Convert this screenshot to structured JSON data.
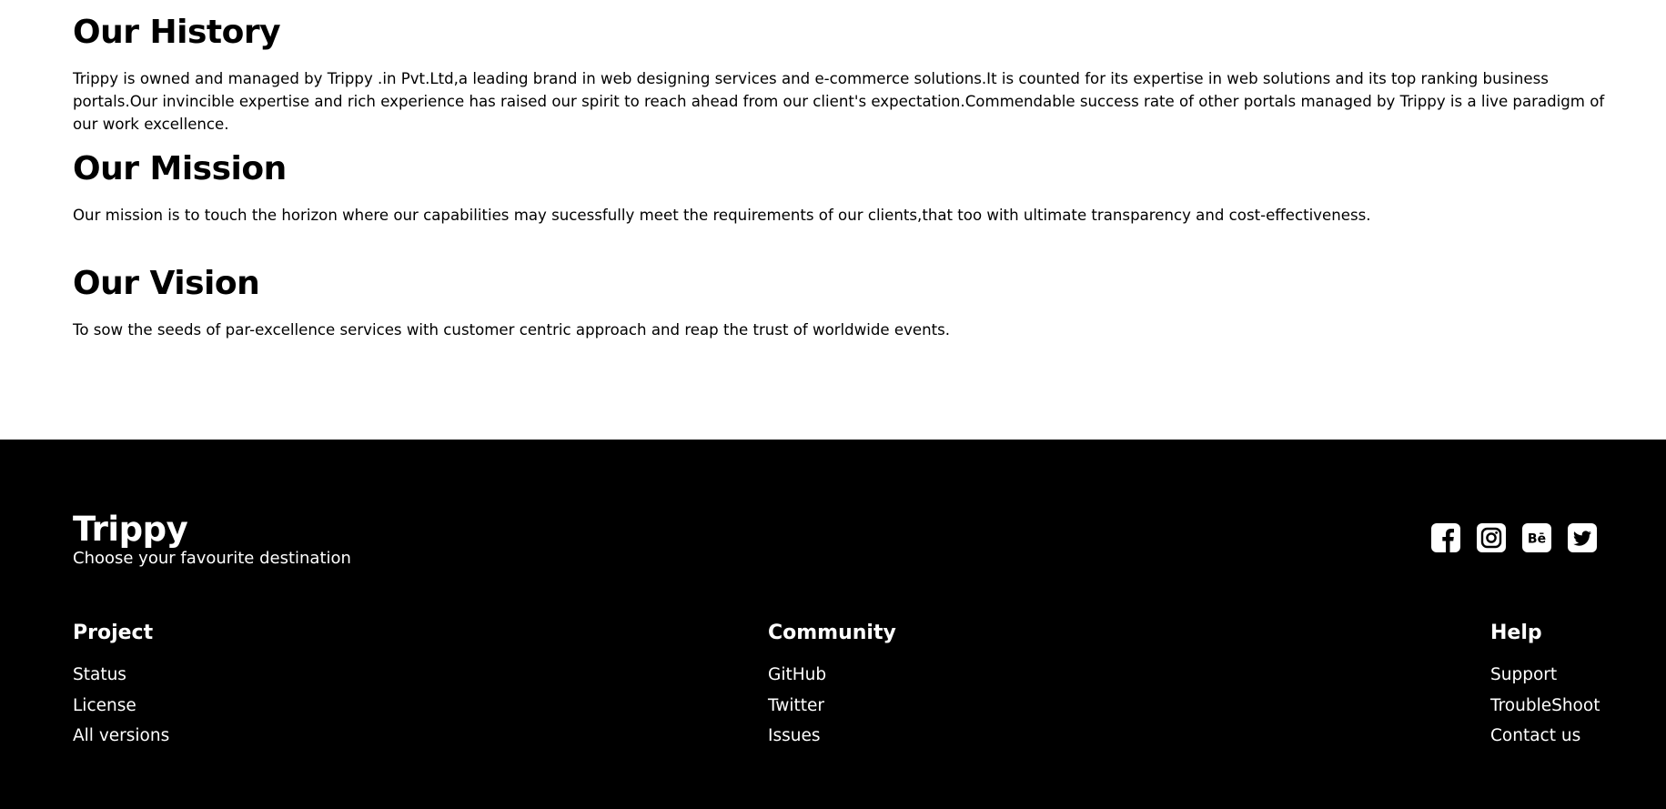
{
  "sections": {
    "history": {
      "title": "Our History",
      "text": "Trippy is owned and managed by Trippy .in Pvt.Ltd,a leading brand in web designing services and e-commerce solutions.It is counted for its expertise in web solutions and its top ranking business portals.Our invincible expertise and rich experience has raised our spirit to reach ahead from our client's expectation.Commendable success rate of other portals managed by Trippy is a live paradigm of our work excellence."
    },
    "mission": {
      "title": "Our Mission",
      "text": "Our mission is to touch the horizon where our capabilities may sucessfully meet the requirements of our clients,that too with ultimate transparency and cost-effectiveness."
    },
    "vision": {
      "title": "Our Vision",
      "text": "To sow the seeds of par-excellence services with customer centric approach and reap the trust of worldwide events."
    }
  },
  "footer": {
    "brand": "Trippy",
    "tagline": "Choose your favourite destination",
    "socials": [
      "facebook-icon",
      "instagram-icon",
      "behance-icon",
      "twitter-icon"
    ],
    "columns": {
      "project": {
        "title": "Project",
        "links": [
          "Status",
          "License",
          "All versions"
        ]
      },
      "community": {
        "title": "Community",
        "links": [
          "GitHub",
          "Twitter",
          "Issues"
        ]
      },
      "help": {
        "title": "Help",
        "links": [
          "Support",
          "TroubleShoot",
          "Contact us"
        ]
      }
    }
  },
  "colors": {
    "page_background": "#ffffff",
    "footer_background": "#000000",
    "footer_text": "#ffffff"
  }
}
